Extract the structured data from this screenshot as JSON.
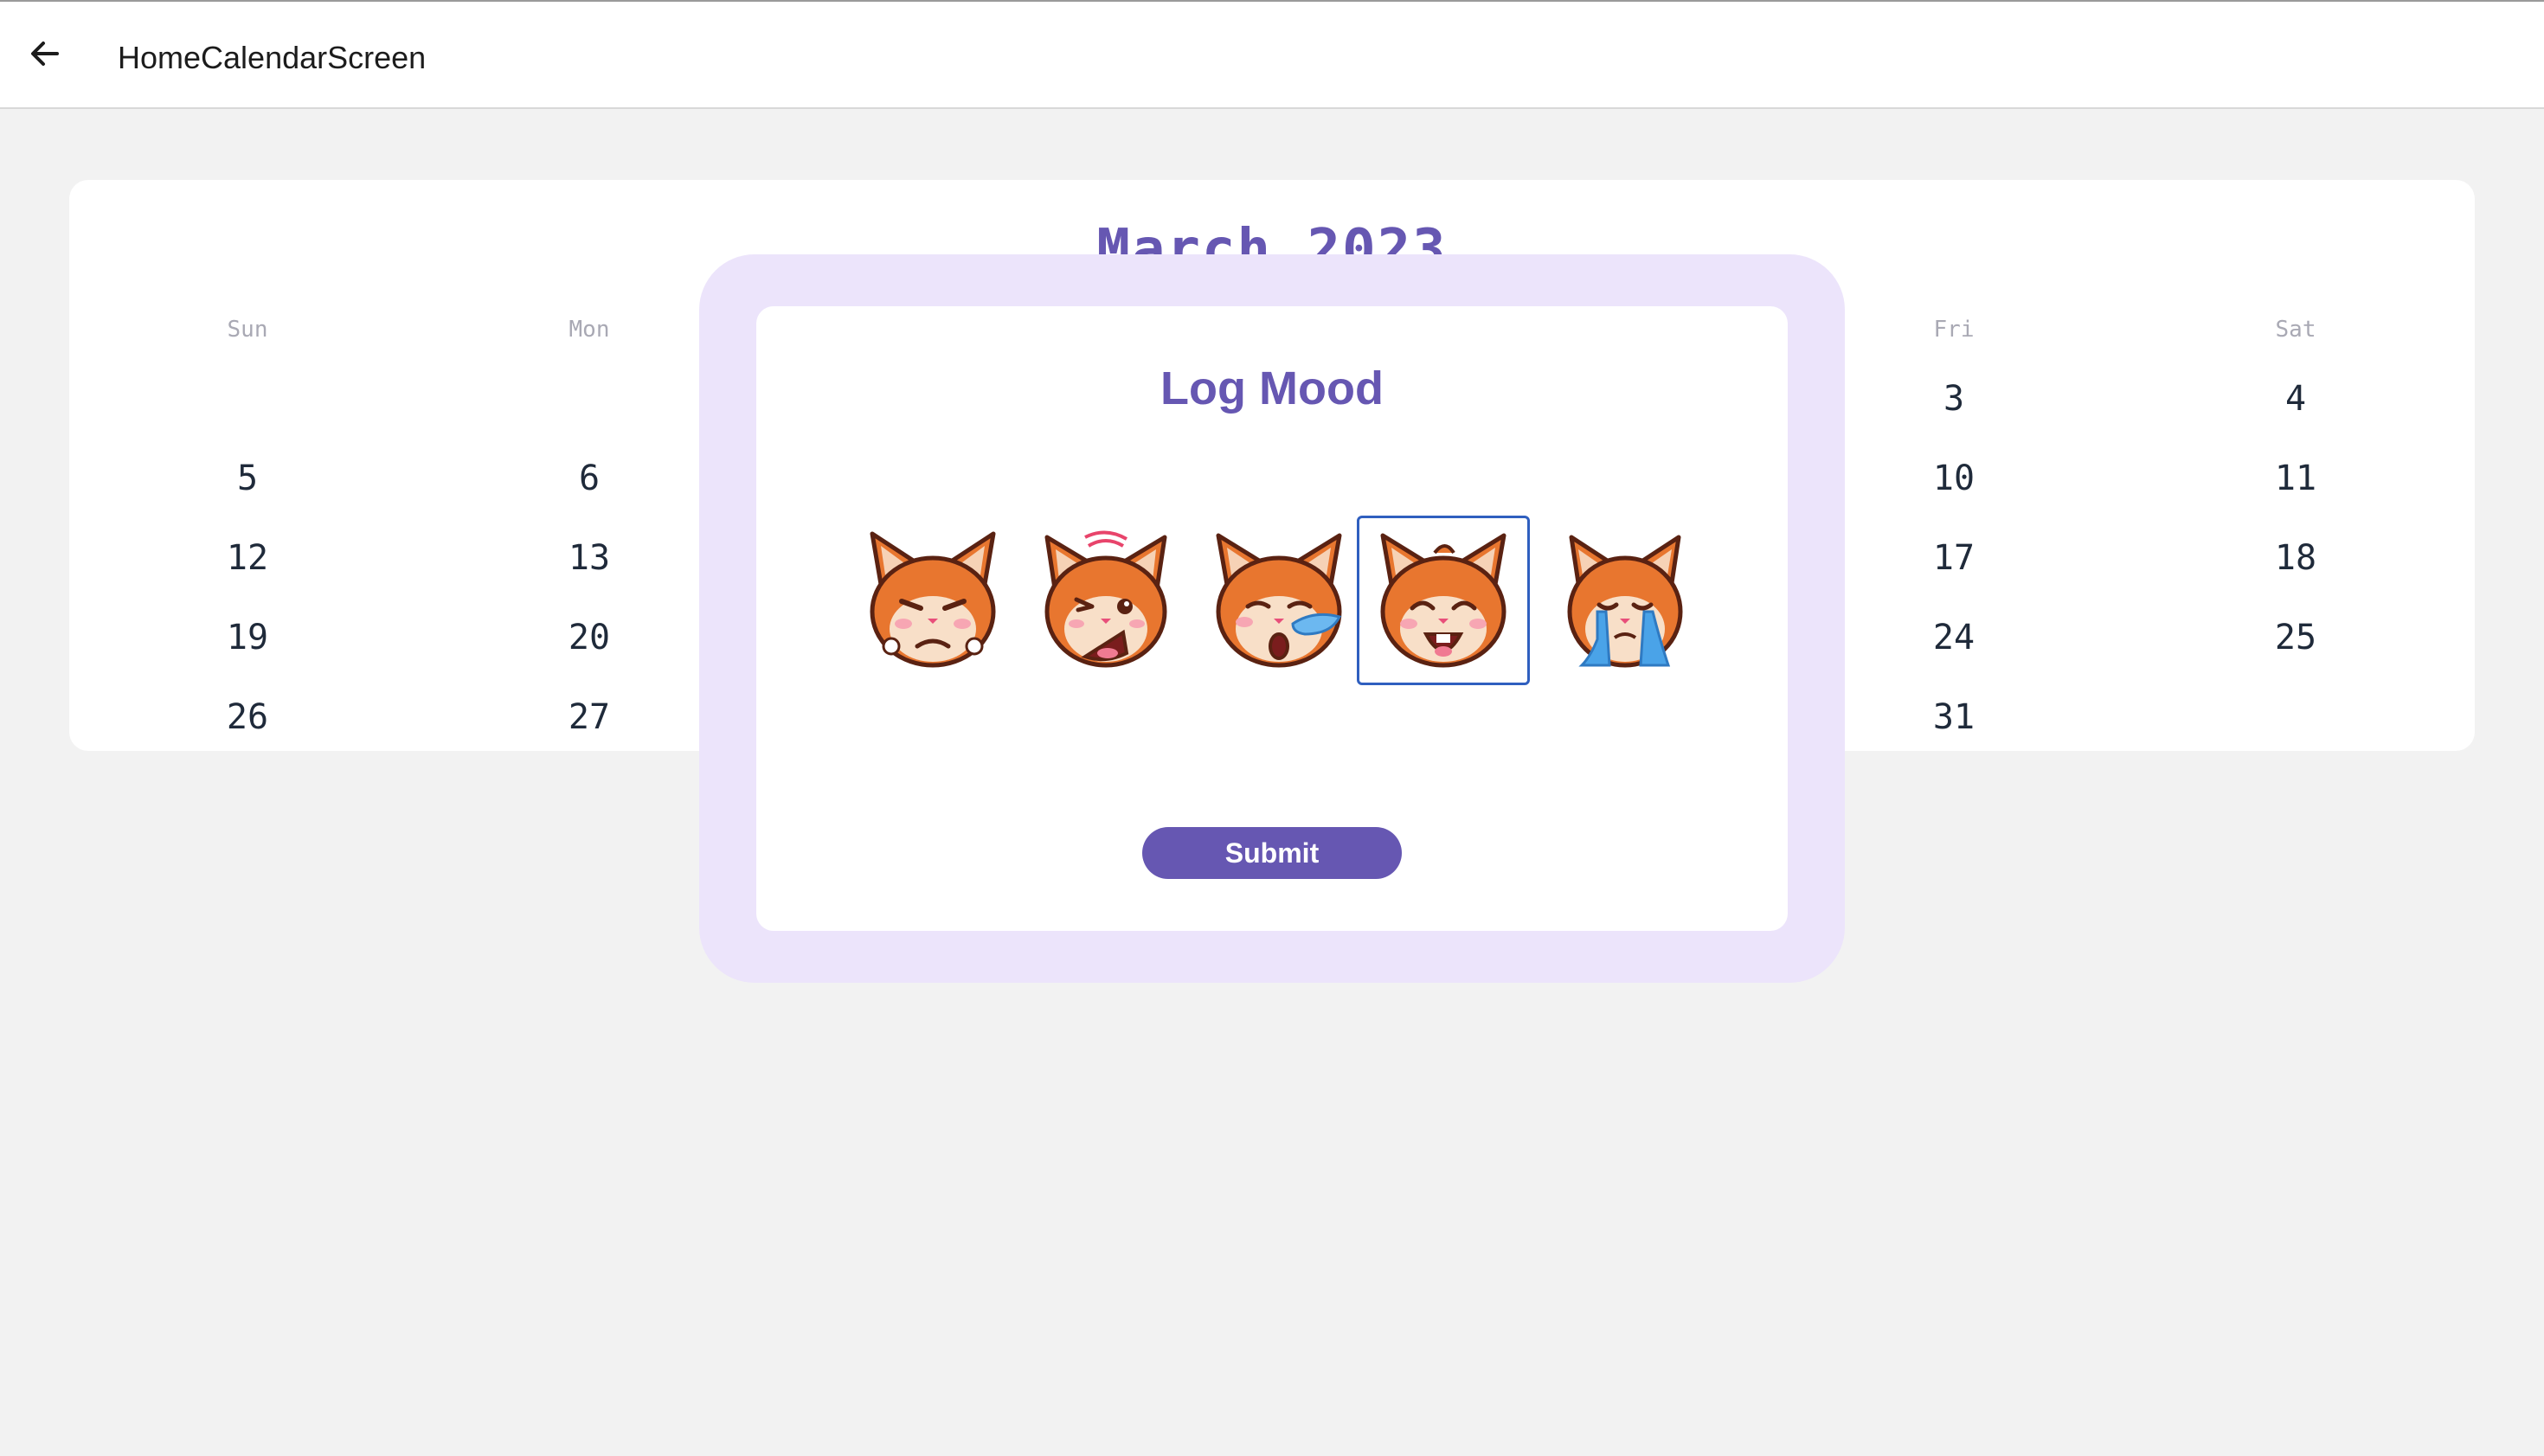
{
  "app_bar": {
    "title": "HomeCalendarScreen",
    "back_icon": "arrow-left-icon"
  },
  "calendar": {
    "month_title": "March 2023",
    "visible_weekdays": [
      {
        "key": "sun",
        "label": "Sun"
      },
      {
        "key": "mon",
        "label": "Mon"
      },
      {
        "key": "fri",
        "label": "Fri"
      },
      {
        "key": "sat",
        "label": "Sat"
      }
    ],
    "visible_days": {
      "sun": [
        "",
        "5",
        "12",
        "19",
        "26"
      ],
      "mon": [
        "",
        "6",
        "13",
        "20",
        "27"
      ],
      "fri": [
        "3",
        "10",
        "17",
        "24",
        "31"
      ],
      "sat": [
        "4",
        "11",
        "18",
        "25",
        ""
      ]
    },
    "accent_color": "#6657b2"
  },
  "dialog": {
    "title": "Log Mood",
    "moods": [
      {
        "name": "angry",
        "icon": "angry-squirrel-icon",
        "selected": false
      },
      {
        "name": "frustrated",
        "icon": "frustrated-squirrel-icon",
        "selected": false
      },
      {
        "name": "tired",
        "icon": "sleepy-squirrel-icon",
        "selected": false
      },
      {
        "name": "happy",
        "icon": "happy-squirrel-icon",
        "selected": true
      },
      {
        "name": "sad",
        "icon": "crying-squirrel-icon",
        "selected": false
      }
    ],
    "submit_label": "Submit",
    "frame_color": "#ece4fb",
    "selection_color": "#2f5fbf"
  }
}
